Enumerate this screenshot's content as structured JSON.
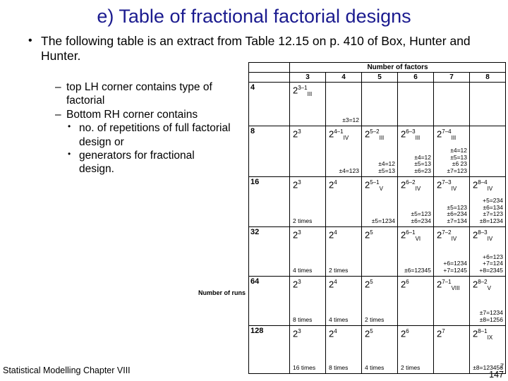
{
  "slide": {
    "title": "e)  Table of fractional factorial designs",
    "bullet": {
      "marker": "•",
      "text": "The following table is an extract from Table 12.15 on p. 410 of Box, Hunter and Hunter."
    },
    "sub_bullets": [
      {
        "marker": "–",
        "text": "top LH corner contains type of factorial"
      },
      {
        "marker": "–",
        "text": "Bottom RH corner contains"
      }
    ],
    "sub_sub_bullets": [
      {
        "marker": "•",
        "text": "no. of repetitions of full factorial design or"
      },
      {
        "marker": "•",
        "text": "generators for fractional design."
      }
    ],
    "footer_left": "Statistical Modelling   Chapter VIII",
    "page_number": "147",
    "page_superscript": "7"
  },
  "table": {
    "col_caption": "Number of factors",
    "row_caption": "Number of runs",
    "col_headers": [
      "3",
      "4",
      "5",
      "6",
      "7",
      "8"
    ],
    "row_headers": [
      "4",
      "8",
      "16",
      "32",
      "64",
      "128"
    ],
    "cells": [
      [
        {
          "main": "2<sup>3–1</sup><sub>III</sub>",
          "note": ""
        },
        {
          "main": "",
          "note": "±3=12"
        },
        {
          "main": "",
          "note": ""
        },
        {
          "main": "",
          "note": ""
        },
        {
          "main": "",
          "note": ""
        },
        {
          "main": "",
          "note": ""
        }
      ],
      [
        {
          "main": "2<sup>3</sup>",
          "note": ""
        },
        {
          "main": "2<sup>4–1</sup><sub>IV</sub>",
          "note": "±4=123"
        },
        {
          "main": "2<sup>5–2</sup><sub>III</sub>",
          "note": "±4=12\n±5=13"
        },
        {
          "main": "2<sup>6–3</sup><sub>III</sub>",
          "note": "±4=12\n±5=13\n±6=23"
        },
        {
          "main": "2<sup>7–4</sup><sub>III</sub>",
          "note": "±4=12\n±5=13\n±6 23\n±7=123"
        },
        {
          "main": "",
          "note": ""
        }
      ],
      [
        {
          "main": "2<sup>3</sup>",
          "note": "2 times"
        },
        {
          "main": "2<sup>4</sup>",
          "note": ""
        },
        {
          "main": "2<sup>5–1</sup><sub>V</sub>",
          "note": "±5=1234"
        },
        {
          "main": "2<sup>6–2</sup><sub>IV</sub>",
          "note": "±5=123\n±6=234"
        },
        {
          "main": "2<sup>7–3</sup><sub>IV</sub>",
          "note": "±5=123\n±6=234\n±7=134"
        },
        {
          "main": "2<sup>8–4</sup><sub>IV</sub>",
          "note": "+5=234\n±6=134\n±7=123\n±8=1234"
        }
      ],
      [
        {
          "main": "2<sup>3</sup>",
          "note": "4 times"
        },
        {
          "main": "2<sup>4</sup>",
          "note": "2 times"
        },
        {
          "main": "2<sup>5</sup>",
          "note": ""
        },
        {
          "main": "2<sup>6–1</sup><sub>VI</sub>",
          "note": "±6=12345"
        },
        {
          "main": "2<sup>7–2</sup><sub>IV</sub>",
          "note": "+6=1234\n+7=1245"
        },
        {
          "main": "2<sup>8–3</sup><sub>IV</sub>",
          "note": "+6=123\n+7=124\n+8=2345"
        }
      ],
      [
        {
          "main": "2<sup>3</sup>",
          "note": "8 times"
        },
        {
          "main": "2<sup>4</sup>",
          "note": "4 times"
        },
        {
          "main": "2<sup>5</sup>",
          "note": "2 times"
        },
        {
          "main": "2<sup>6</sup>",
          "note": ""
        },
        {
          "main": "2<sup>7–1</sup><sub>VIII</sub>",
          "note": ""
        },
        {
          "main": "2<sup>8–2</sup><sub>V</sub>",
          "note": "±7=1234\n±8=1256"
        }
      ],
      [
        {
          "main": "2<sup>3</sup>",
          "note": "16 times"
        },
        {
          "main": "2<sup>4</sup>",
          "note": "8 times"
        },
        {
          "main": "2<sup>5</sup>",
          "note": "4 times"
        },
        {
          "main": "2<sup>6</sup>",
          "note": "2 times"
        },
        {
          "main": "2<sup>7</sup>",
          "note": ""
        },
        {
          "main": "2<sup>8–1</sup><sub>IX</sub>",
          "note": "±8=123456"
        }
      ]
    ]
  }
}
